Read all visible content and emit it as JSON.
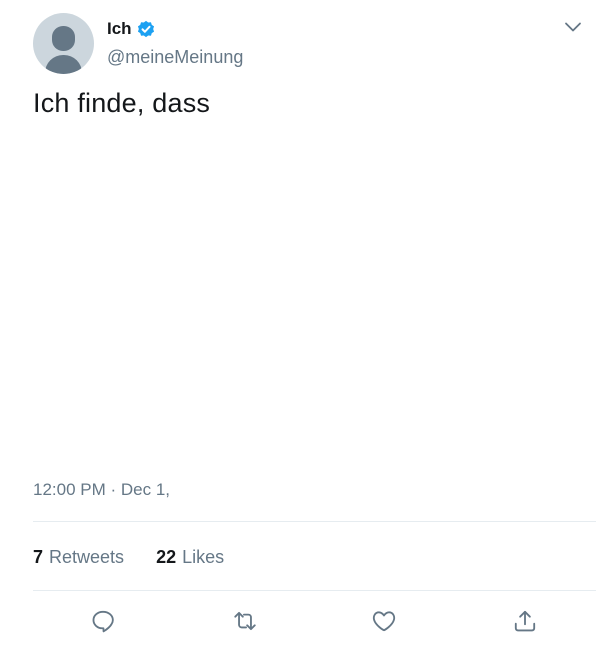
{
  "author": {
    "display_name": "Ich",
    "handle": "@meineMeinung",
    "verified": true
  },
  "tweet": {
    "text": "Ich finde, dass",
    "timestamp": "12:00 PM · Dec 1,"
  },
  "stats": {
    "retweets_count": "7",
    "retweets_label": "Retweets",
    "likes_count": "22",
    "likes_label": "Likes"
  },
  "icons": {
    "verified": "verified-badge-icon",
    "caret": "chevron-down-icon",
    "reply": "reply-icon",
    "retweet": "retweet-icon",
    "like": "heart-icon",
    "share": "share-icon"
  },
  "colors": {
    "primary_text": "#14171a",
    "secondary_text": "#657786",
    "verified_blue": "#1da1f2",
    "divider": "#e6ecf0",
    "avatar_bg": "#ccd6dd",
    "avatar_fg": "#657786"
  }
}
